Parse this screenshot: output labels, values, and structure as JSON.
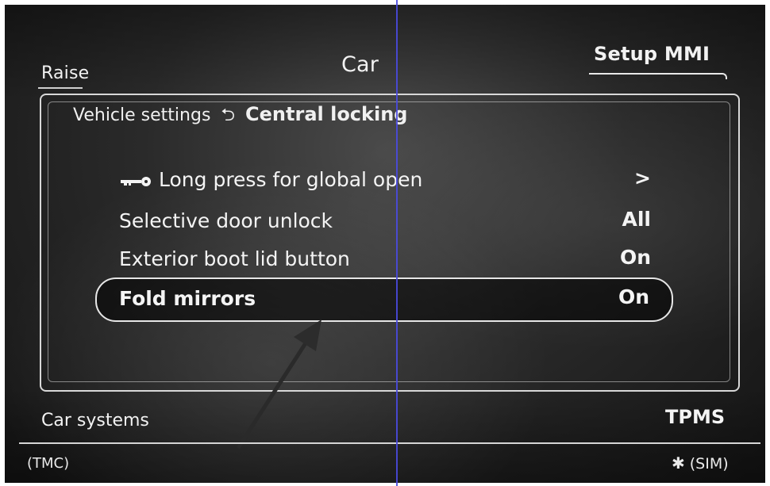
{
  "header": {
    "left_label": "Raise",
    "center_label": "Car",
    "right_label": "Setup MMI"
  },
  "breadcrumb": {
    "parent": "Vehicle settings",
    "back_glyph": "⮌",
    "current": "Central locking"
  },
  "menu": {
    "items": [
      {
        "label": "Long press for global open",
        "value": ">",
        "icon": "key-icon"
      },
      {
        "label": "Selective door unlock",
        "value": "All"
      },
      {
        "label": "Exterior boot lid button",
        "value": "On"
      },
      {
        "label": "Fold mirrors",
        "value": "On",
        "selected": true
      }
    ]
  },
  "footer": {
    "left_label": "Car systems",
    "right_label": "TPMS"
  },
  "status_bar": {
    "left": "(TMC)",
    "bluetooth_icon": "bluetooth-icon",
    "right": "(SIM)"
  },
  "colors": {
    "background": "#1e1e1e",
    "text": "#f2f2f2",
    "frame_lines": "#d8d8d8",
    "annotation_line": "#4a4ae0"
  }
}
